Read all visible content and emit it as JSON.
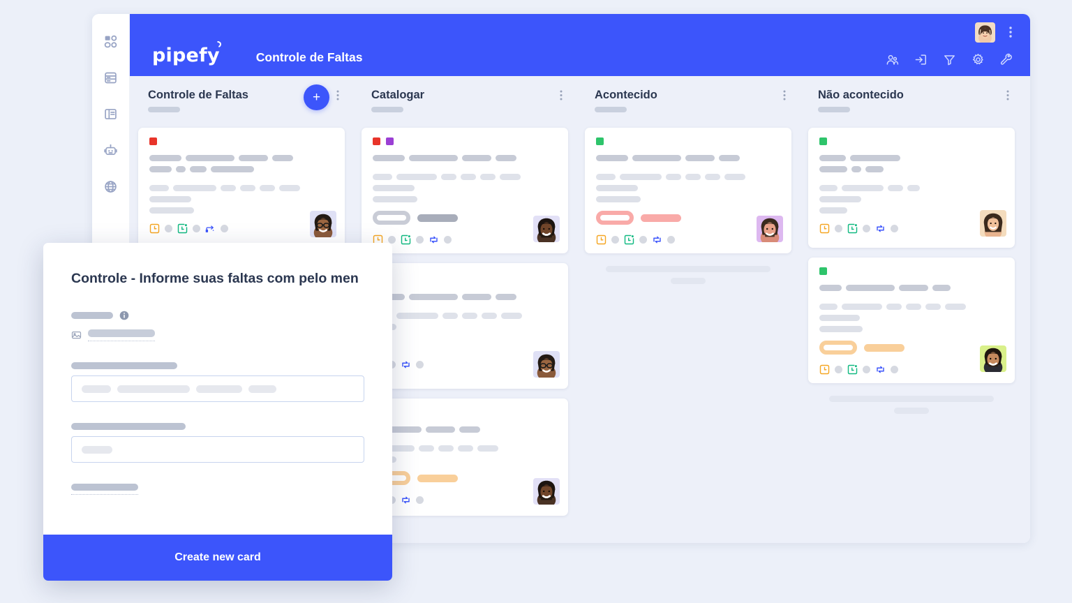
{
  "header": {
    "logo_text": "pipefy",
    "board_title": "Controle de Faltas",
    "avatar_name": "user-avatar",
    "kebab_label": "⋮",
    "icons": [
      {
        "name": "members-icon",
        "label": "Members"
      },
      {
        "name": "inbox-import-icon",
        "label": "Inbox"
      },
      {
        "name": "filter-icon",
        "label": "Filter"
      },
      {
        "name": "settings-gear-icon",
        "label": "Settings"
      },
      {
        "name": "wrench-tools-icon",
        "label": "Tools"
      }
    ]
  },
  "sidebar": {
    "items": [
      {
        "name": "dashboard-grid-icon",
        "label": "Dashboard"
      },
      {
        "name": "database-icon",
        "label": "Database"
      },
      {
        "name": "layout-panel-icon",
        "label": "Layout"
      },
      {
        "name": "automation-robot-icon",
        "label": "Automations"
      },
      {
        "name": "globe-icon",
        "label": "Portal"
      }
    ]
  },
  "board": {
    "columns": [
      {
        "title": "Controle de Faltas",
        "has_add_button": true,
        "add_label": "+",
        "kebab_label": "⋮",
        "cards": [
          {
            "chips": [
              "#e8342a"
            ],
            "badge": null,
            "avatar": "avatar-glasses-woman",
            "footer_icons": [
              "clock-orange-icon",
              "calendar-check-green-icon",
              "flow-blue-icon"
            ]
          }
        ],
        "loader": false
      },
      {
        "title": "Catalogar",
        "has_add_button": false,
        "kebab_label": "⋮",
        "cards": [
          {
            "chips": [
              "#e8342a",
              "#9b3fd4"
            ],
            "badge": {
              "pill": "#ffffff",
              "border": "#c9ccd6",
              "bar": "#a8adba"
            },
            "avatar": "avatar-bearded-man",
            "footer_icons": [
              "clock-orange-icon",
              "calendar-check-green-icon",
              "sync-blue-icon"
            ]
          },
          {
            "chips": [],
            "badge": null,
            "avatar": "avatar-glasses-woman",
            "footer_icons": [
              "calendar-check-green-icon",
              "sync-blue-icon"
            ]
          },
          {
            "chips": [],
            "badge": {
              "pill": "#f9cf9a",
              "border": "#f9cf9a",
              "bar": "#f9cf9a"
            },
            "avatar": "avatar-bearded-man",
            "footer_icons": [
              "calendar-check-green-icon",
              "sync-blue-icon"
            ]
          }
        ],
        "loader": false
      },
      {
        "title": "Acontecido",
        "has_add_button": false,
        "kebab_label": "⋮",
        "cards": [
          {
            "chips": [
              "#2ec46b"
            ],
            "badge": {
              "pill": "#f9aaa8",
              "border": "#f9aaa8",
              "bar": "#f9aaa8"
            },
            "avatar": "avatar-smiling-man",
            "footer_icons": [
              "clock-orange-icon",
              "calendar-check-green-icon",
              "sync-blue-icon"
            ]
          }
        ],
        "loader": true
      },
      {
        "title": "Não acontecido",
        "has_add_button": false,
        "kebab_label": "⋮",
        "cards": [
          {
            "chips": [
              "#2ec46b"
            ],
            "badge": null,
            "avatar": "avatar-smiling-woman",
            "footer_icons": [
              "clock-orange-icon",
              "calendar-check-green-icon",
              "sync-blue-icon"
            ]
          },
          {
            "chips": [
              "#2ec46b"
            ],
            "badge": {
              "pill": "#f9cf9a",
              "border": "#f9cf9a",
              "bar": "#f9cf9a"
            },
            "avatar": "avatar-young-man",
            "footer_icons": [
              "clock-orange-icon",
              "calendar-check-green-icon",
              "sync-blue-icon"
            ]
          }
        ],
        "loader": true
      }
    ]
  },
  "modal": {
    "title": "Controle - Informe suas faltas com pelo men",
    "submit_label": "Create new card",
    "info_icon": "info-icon",
    "picture_icon": "picture-icon"
  },
  "colors": {
    "brand_blue": "#3c55fb",
    "page_bg": "#ecf0f9",
    "board_bg": "#edf0f9",
    "title_text": "#2b3750",
    "chip_red": "#e8342a",
    "chip_purple": "#9b3fd4",
    "chip_green": "#2ec46b",
    "badge_orange": "#f9cf9a",
    "badge_pink": "#f9aaa8",
    "icon_orange": "#f5a623",
    "icon_green": "#11b981",
    "icon_blue": "#3c55fb"
  }
}
